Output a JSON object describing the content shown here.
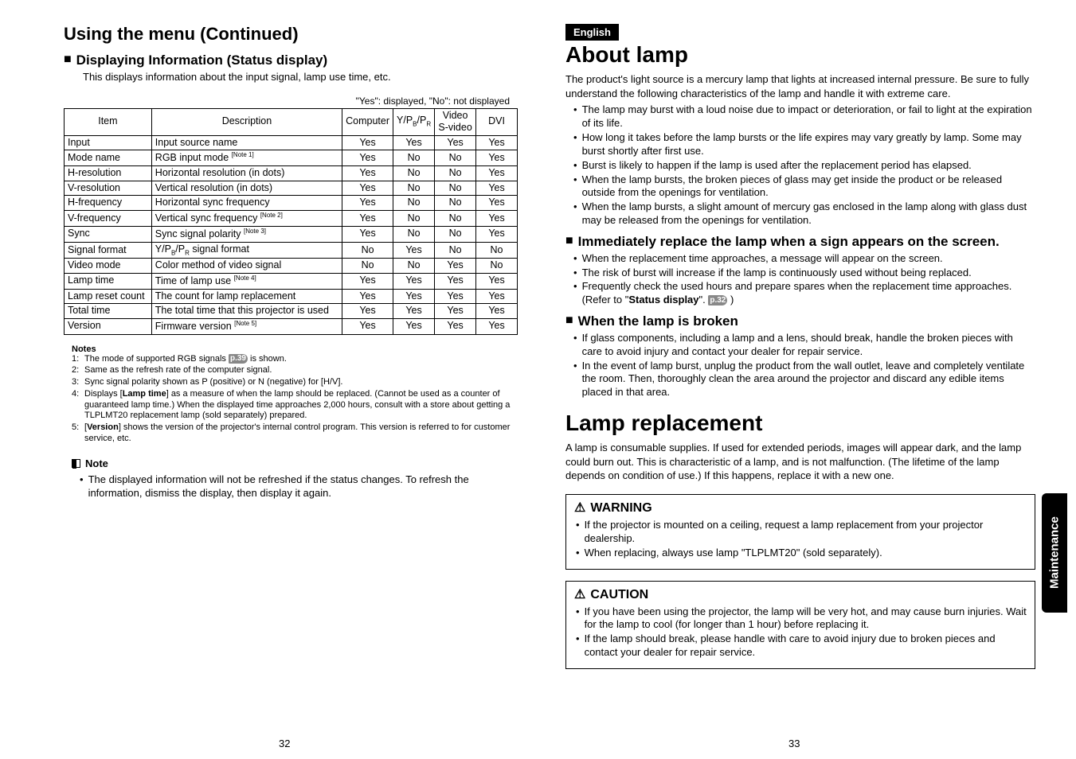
{
  "left": {
    "title": "Using the menu (Continued)",
    "section_title": "Displaying Information (Status display)",
    "section_sub": "This displays information about the input signal, lamp use time, etc.",
    "table_caption": "\"Yes\": displayed, \"No\": not displayed",
    "headers": {
      "item": "Item",
      "desc": "Description",
      "c1": "Computer",
      "c2": "Y/PB/PR",
      "c3": "Video S-video",
      "c4": "DVI"
    },
    "rows": [
      {
        "item": "Input",
        "desc": "Input source name",
        "c1": "Yes",
        "c2": "Yes",
        "c3": "Yes",
        "c4": "Yes",
        "note": ""
      },
      {
        "item": "Mode name",
        "desc": "RGB input mode",
        "c1": "Yes",
        "c2": "No",
        "c3": "No",
        "c4": "Yes",
        "note": "[Note 1]"
      },
      {
        "item": "H-resolution",
        "desc": "Horizontal resolution (in dots)",
        "c1": "Yes",
        "c2": "No",
        "c3": "No",
        "c4": "Yes",
        "note": ""
      },
      {
        "item": "V-resolution",
        "desc": "Vertical resolution (in dots)",
        "c1": "Yes",
        "c2": "No",
        "c3": "No",
        "c4": "Yes",
        "note": ""
      },
      {
        "item": "H-frequency",
        "desc": "Horizontal sync frequency",
        "c1": "Yes",
        "c2": "No",
        "c3": "No",
        "c4": "Yes",
        "note": ""
      },
      {
        "item": "V-frequency",
        "desc": "Vertical sync frequency",
        "c1": "Yes",
        "c2": "No",
        "c3": "No",
        "c4": "Yes",
        "note": "[Note 2]"
      },
      {
        "item": "Sync",
        "desc": "Sync signal polarity",
        "c1": "Yes",
        "c2": "No",
        "c3": "No",
        "c4": "Yes",
        "note": "[Note 3]"
      },
      {
        "item": "Signal format",
        "desc": "Y/PB/PR signal format",
        "c1": "No",
        "c2": "Yes",
        "c3": "No",
        "c4": "No",
        "note": ""
      },
      {
        "item": "Video mode",
        "desc": "Color method of video signal",
        "c1": "No",
        "c2": "No",
        "c3": "Yes",
        "c4": "No",
        "note": ""
      },
      {
        "item": "Lamp time",
        "desc": "Time of lamp use",
        "c1": "Yes",
        "c2": "Yes",
        "c3": "Yes",
        "c4": "Yes",
        "note": "[Note 4]"
      },
      {
        "item": "Lamp reset count",
        "desc": "The count for lamp replacement",
        "c1": "Yes",
        "c2": "Yes",
        "c3": "Yes",
        "c4": "Yes",
        "note": ""
      },
      {
        "item": "Total time",
        "desc": "The total time that this projector is used",
        "c1": "Yes",
        "c2": "Yes",
        "c3": "Yes",
        "c4": "Yes",
        "note": ""
      },
      {
        "item": "Version",
        "desc": "Firmware version",
        "c1": "Yes",
        "c2": "Yes",
        "c3": "Yes",
        "c4": "Yes",
        "note": "[Note 5]"
      }
    ],
    "notes_title": "Notes",
    "notes": [
      {
        "n": "1:",
        "t_pre": "The mode of supported RGB signals ",
        "pref": "p.39",
        "t_post": " is shown."
      },
      {
        "n": "2:",
        "t_pre": "Same as the refresh rate of the computer signal.",
        "pref": "",
        "t_post": ""
      },
      {
        "n": "3:",
        "t_pre": "Sync signal polarity shown as P (positive) or N (negative) for [H/V].",
        "pref": "",
        "t_post": ""
      },
      {
        "n": "4:",
        "t_pre": "Displays [Lamp time] as a measure of when the lamp should be replaced. (Cannot be used as a counter of guaranteed lamp time.) When the displayed time approaches 2,000 hours, consult with a store about getting a TLPLMT20 replacement lamp (sold separately) prepared.",
        "pref": "",
        "t_post": ""
      },
      {
        "n": "5:",
        "t_pre": "[Version] shows the version of the projector's internal control program. This version is referred to for customer service, etc.",
        "pref": "",
        "t_post": ""
      }
    ],
    "note_label": "Note",
    "note_bullet": "The displayed information will not be refreshed if the status changes. To refresh the information, dismiss the display, then display it again.",
    "pagenum": "32"
  },
  "right": {
    "english": "English",
    "about_title": "About lamp",
    "about_intro": "The product's light source is a mercury lamp that lights at increased internal pressure. Be sure to fully understand the following characteristics of the lamp and handle it with extreme care.",
    "about_bullets": [
      "The lamp may burst with a loud noise due to impact or deterioration, or fail to light at the expiration of its life.",
      "How long it takes before the lamp bursts or the life expires may vary greatly by lamp. Some may burst shortly after first use.",
      "Burst is likely to happen if the lamp is used after the replacement period has elapsed.",
      "When the lamp bursts, the broken pieces of glass may get inside the product or be released outside from the openings for ventilation.",
      "When the lamp bursts, a slight amount of mercury gas enclosed in the lamp along with glass dust may be released from the openings for ventilation."
    ],
    "replace_head": "Immediately replace the lamp when a sign appears on the screen.",
    "replace_bullets": [
      "When the replacement time approaches, a message will appear on the screen.",
      "The risk of burst will increase if the lamp is continuously used without being replaced."
    ],
    "replace_bullet3_pre": "Frequently check the used hours and prepare spares when the replacement time approaches. (Refer to \"",
    "replace_bullet3_bold": "Status display",
    "replace_bullet3_mid": "\". ",
    "replace_bullet3_pref": "p.32",
    "replace_bullet3_post": " )",
    "broken_head": "When the lamp is broken",
    "broken_bullets": [
      "If glass components, including a lamp and a lens, should break, handle the broken pieces with care to avoid injury and contact your dealer for repair service.",
      "In the event of lamp burst, unplug the product from the wall outlet, leave and completely ventilate the room. Then, thoroughly clean the area around the projector and discard any edible items placed in that area."
    ],
    "replacement_title": "Lamp replacement",
    "replacement_intro": "A lamp is consumable supplies. If used for extended periods, images will appear dark, and the lamp could burn out. This is characteristic of a lamp, and is not malfunction. (The lifetime of the lamp depends on condition of use.) If this happens, replace it with a new one.",
    "warning_label": "WARNING",
    "warning_bullets": [
      "If the projector is mounted on a ceiling, request a lamp replacement from your projector dealership.",
      "When replacing, always use lamp \"TLPLMT20\" (sold separately)."
    ],
    "caution_label": "CAUTION",
    "caution_bullets": [
      "If you have been using the projector, the lamp will be very hot, and may cause burn injuries. Wait for the lamp to cool (for longer than 1 hour) before replacing it.",
      "If the lamp should break, please handle with care to avoid injury due to broken pieces and contact your dealer for repair service."
    ],
    "side_tab": "Maintenance",
    "pagenum": "33"
  }
}
